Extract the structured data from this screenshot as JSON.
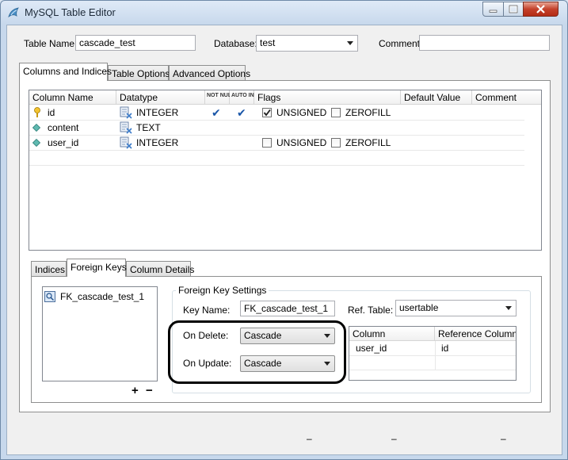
{
  "window": {
    "title": "MySQL Table Editor"
  },
  "form": {
    "table_name_label": "Table Name:",
    "table_name_value": "cascade_test",
    "database_label": "Database:",
    "database_value": "test",
    "comment_label": "Comment:",
    "comment_value": ""
  },
  "main_tabs": [
    "Columns and Indices",
    "Table Options",
    "Advanced Options"
  ],
  "columns_grid": {
    "headers": {
      "name": "Column Name",
      "datatype": "Datatype",
      "not_null": "NOT NULL",
      "auto_inc": "AUTO INC",
      "flags": "Flags",
      "default": "Default Value",
      "comment": "Comment"
    },
    "rows": [
      {
        "name": "id",
        "datatype": "INTEGER",
        "not_null": true,
        "auto_inc": true,
        "unsigned": true,
        "zerofill": false,
        "primary_key": true,
        "has_flags": true
      },
      {
        "name": "content",
        "datatype": "TEXT",
        "not_null": false,
        "auto_inc": false,
        "unsigned": false,
        "zerofill": false,
        "primary_key": false,
        "has_flags": false
      },
      {
        "name": "user_id",
        "datatype": "INTEGER",
        "not_null": false,
        "auto_inc": false,
        "unsigned": false,
        "zerofill": false,
        "primary_key": false,
        "has_flags": true
      }
    ],
    "unsigned_label": "UNSIGNED",
    "zerofill_label": "ZEROFILL"
  },
  "sub_tabs": [
    "Indices",
    "Foreign Keys",
    "Column Details"
  ],
  "foreign_keys": {
    "list": [
      "FK_cascade_test_1"
    ],
    "add_label": "+",
    "remove_label": "−",
    "settings_title": "Foreign Key Settings",
    "key_name_label": "Key Name:",
    "key_name_value": "FK_cascade_test_1",
    "ref_table_label": "Ref. Table:",
    "ref_table_value": "usertable",
    "on_delete_label": "On Delete:",
    "on_delete_value": "Cascade",
    "on_update_label": "On Update:",
    "on_update_value": "Cascade",
    "mapping_headers": {
      "column": "Column",
      "reference": "Reference Column"
    },
    "mapping_rows": [
      {
        "column": "user_id",
        "reference": "id"
      }
    ]
  },
  "footer": {
    "dash_1": "–",
    "dash_2": "–",
    "dash_3": "–"
  },
  "colors": {
    "title_bar": "#c7d8ec",
    "close_button": "#c4412b",
    "highlight_ring": "#000000"
  }
}
